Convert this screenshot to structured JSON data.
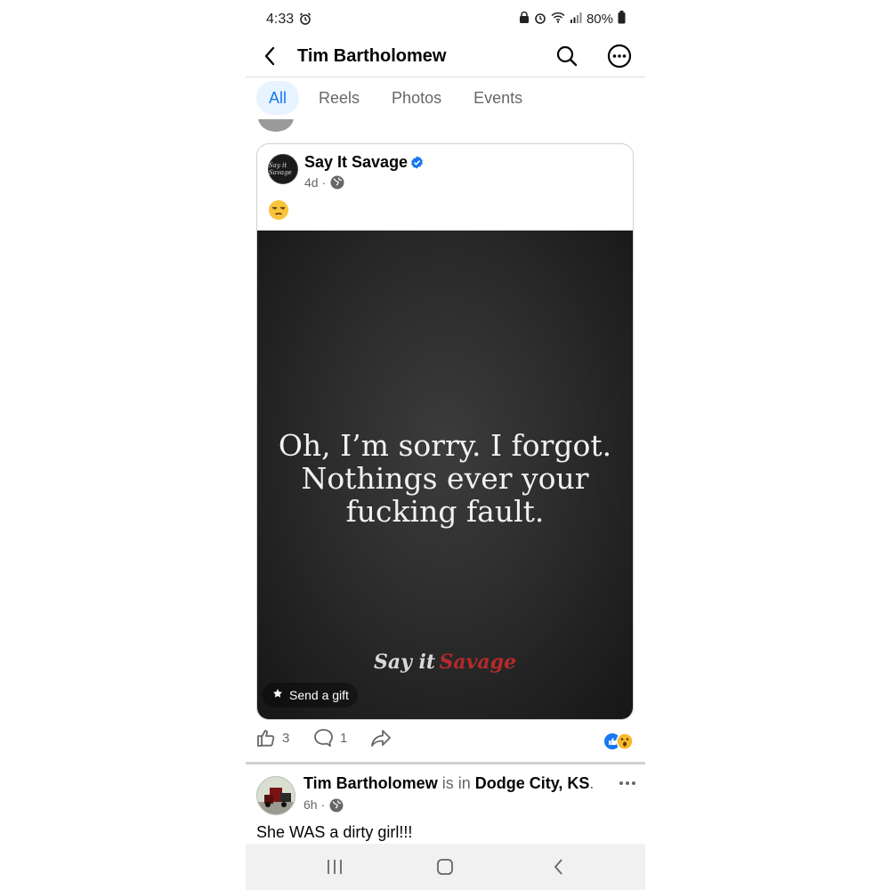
{
  "status_bar": {
    "time": "4:33",
    "battery": "80%"
  },
  "header": {
    "title": "Tim Bartholomew"
  },
  "tabs": [
    {
      "label": "All",
      "active": true
    },
    {
      "label": "Reels",
      "active": false
    },
    {
      "label": "Photos",
      "active": false
    },
    {
      "label": "Events",
      "active": false
    }
  ],
  "shared_post": {
    "page_name": "Say It Savage",
    "time": "4d",
    "caption_emoji": "unamused-face",
    "quote_lines": [
      "Oh, I’m sorry. I forgot.",
      "Nothings ever your",
      "fucking fault."
    ],
    "watermark": {
      "part1": "Say it",
      "part2": "Savage"
    },
    "avatar_text": "Say it Savage",
    "send_gift_label": "Send a gift",
    "likes": "3",
    "comments": "1",
    "reactions": [
      "like",
      "wow"
    ]
  },
  "next_post": {
    "author": "Tim Bartholomew",
    "is_in": "is in",
    "location": "Dodge City, KS",
    "time": "6h",
    "text": "She WAS a dirty girl!!!"
  },
  "colors": {
    "accent": "#1877f2",
    "tab_active_bg": "#e7f3ff",
    "muted": "#65676b",
    "watermark_red": "#b42a2a"
  }
}
